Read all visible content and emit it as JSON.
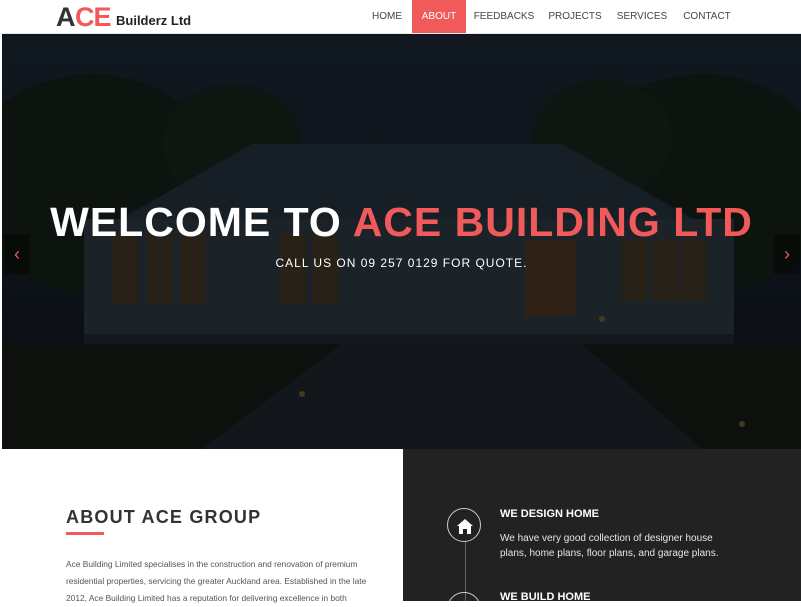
{
  "logo": {
    "a": "A",
    "ce": "CE",
    "sub": "Builderz Ltd"
  },
  "nav": {
    "items": [
      {
        "label": "HOME"
      },
      {
        "label": "ABOUT",
        "active": true
      },
      {
        "label": "FEEDBACKS"
      },
      {
        "label": "PROJECTS"
      },
      {
        "label": "SERVICES"
      },
      {
        "label": "CONTACT"
      }
    ]
  },
  "hero": {
    "title_prefix": "WELCOME TO ",
    "title_accent": "ACE BUILDING LTD",
    "subtitle": "CALL US ON 09 257 0129 FOR QUOTE.",
    "prev_icon": "chevron-left-icon",
    "next_icon": "chevron-right-icon"
  },
  "about": {
    "title": "ABOUT ACE GROUP",
    "body": "Ace Building Limited specialises in the construction and renovation of premium residential properties, servicing the greater Auckland area. Established in the late 2012, Ace Building Limited has a reputation for delivering excellence in both"
  },
  "services": {
    "items": [
      {
        "icon": "home-icon",
        "title": "WE DESIGN HOME",
        "text": "We have very good collection of designer house plans, home plans, floor plans, and garage plans."
      },
      {
        "icon": "building-icon",
        "title": "WE BUILD HOME",
        "text": ""
      }
    ]
  },
  "colors": {
    "accent": "#f05a5a",
    "dark_panel": "#222222",
    "text_dark": "#333333"
  }
}
